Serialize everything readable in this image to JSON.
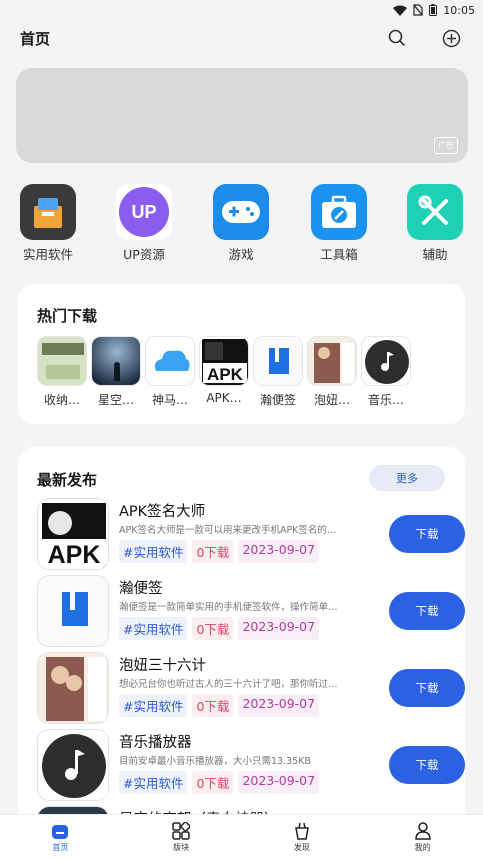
{
  "status": {
    "time": "10:05"
  },
  "header": {
    "title": "首页"
  },
  "banner": {
    "ad_label": "广告"
  },
  "categories": [
    {
      "label": "实用软件",
      "icon": "toolbox-icon",
      "color": "#3a3a3a"
    },
    {
      "label": "UP资源",
      "icon": "up-icon",
      "color": "#8a5cf0"
    },
    {
      "label": "游戏",
      "icon": "gamepad-icon",
      "color": "#1e8ce8"
    },
    {
      "label": "工具箱",
      "icon": "tool-case-icon",
      "color": "#1a93f0"
    },
    {
      "label": "辅助",
      "icon": "wrench-icon",
      "color": "#1ed1b4"
    }
  ],
  "hot": {
    "title": "热门下载",
    "items": [
      {
        "label": "收纳…"
      },
      {
        "label": "星空…"
      },
      {
        "label": "神马…"
      },
      {
        "label": "APK…"
      },
      {
        "label": "瀚便签"
      },
      {
        "label": "泡妞…"
      },
      {
        "label": "音乐…"
      }
    ]
  },
  "latest": {
    "title": "最新发布",
    "more_label": "更多",
    "apps": [
      {
        "name": "APK签名大师",
        "desc": "APK签名大师是一款可以用来更改手机APK签名的…",
        "category": "#实用软件",
        "downloads": "0下载",
        "date": "2023-09-07",
        "button": "下载"
      },
      {
        "name": "瀚便签",
        "desc": "瀚便签是一款简单实用的手机便签软件，操作简单…",
        "category": "#实用软件",
        "downloads": "0下载",
        "date": "2023-09-07",
        "button": "下载"
      },
      {
        "name": "泡妞三十六计",
        "desc": "想必兄台你也听过古人的三十六计了吧，那你听过…",
        "category": "#实用软件",
        "downloads": "0下载",
        "date": "2023-09-07",
        "button": "下载"
      },
      {
        "name": "音乐播放器",
        "desc": "目前安卓最小音乐播放器，大小只需13.35KB",
        "category": "#实用软件",
        "downloads": "0下载",
        "date": "2023-09-07",
        "button": "下载"
      },
      {
        "name": "星空的宇望（表白神器）"
      }
    ]
  },
  "nav": [
    {
      "label": "首页",
      "active": true
    },
    {
      "label": "版块"
    },
    {
      "label": "发现"
    },
    {
      "label": "我的"
    }
  ]
}
